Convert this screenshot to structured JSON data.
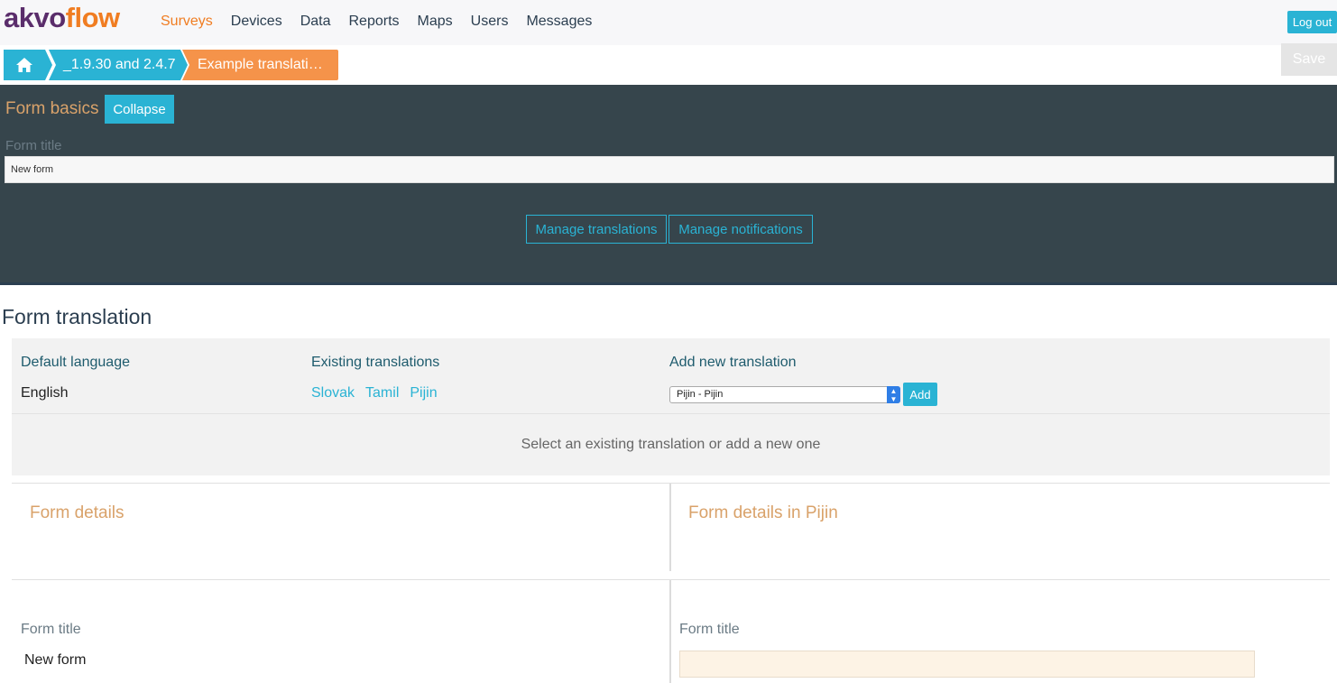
{
  "app": {
    "logo_part1": "akvo",
    "logo_part2": "flow",
    "colors": {
      "accent": "#2ab3d4",
      "brand_orange": "#f07d22",
      "dark_panel": "#36454c"
    }
  },
  "nav": {
    "items": [
      "Surveys",
      "Devices",
      "Data",
      "Reports",
      "Maps",
      "Users",
      "Messages"
    ],
    "active": "Surveys",
    "logout_label": "Log out"
  },
  "breadcrumb": {
    "home_icon": "home-icon",
    "items": [
      "_1.9.30 and 2.4.7",
      "Example translati…"
    ]
  },
  "toolbar": {
    "save_label": "Save"
  },
  "form_basics": {
    "title": "Form basics",
    "collapse_label": "Collapse",
    "form_title_label": "Form title",
    "form_title_value": "New form",
    "manage_translations_label": "Manage translations",
    "manage_notifications_label": "Manage notifications"
  },
  "translation": {
    "heading": "Form translation",
    "default_language_label": "Default language",
    "default_language_value": "English",
    "existing_label": "Existing translations",
    "existing": [
      "Slovak",
      "Tamil",
      "Pijin"
    ],
    "add_new_label": "Add new translation",
    "select_value": "Pijin - Pijin",
    "add_label": "Add",
    "hint": "Select an existing translation or add a new one"
  },
  "details": {
    "left_title": "Form details",
    "right_title": "Form details in Pijin",
    "left_field_label": "Form title",
    "left_field_value": "New form",
    "right_field_label": "Form title",
    "right_field_value": ""
  }
}
